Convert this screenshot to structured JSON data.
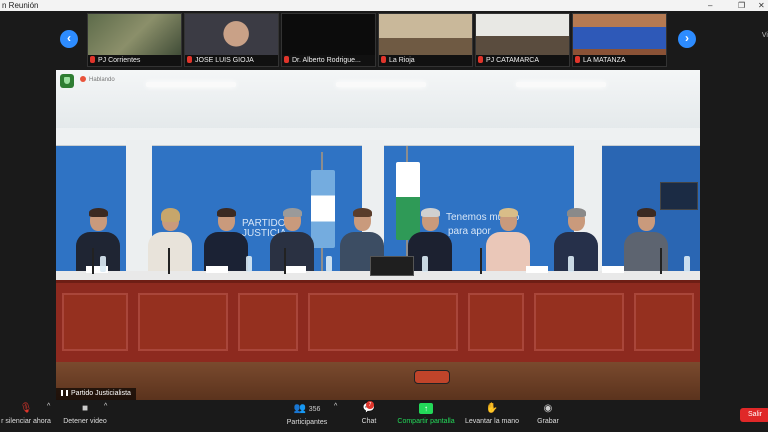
{
  "window": {
    "title": "n Reunión"
  },
  "thumbnails": [
    {
      "label": "PJ Corrientes"
    },
    {
      "label": "JOSE LUIS GIOJA"
    },
    {
      "label": "Dr. Alberto Rodrigue..."
    },
    {
      "label": "La Rioja"
    },
    {
      "label": "PJ CATAMARCA"
    },
    {
      "label": "LA MATANZA"
    }
  ],
  "view_link": "Vi",
  "main_video": {
    "speaking": "Hablando",
    "participant": "Partido Justicialista",
    "wall_text_left_1": "PARTIDO",
    "wall_text_left_2": "JUSTICIA",
    "wall_text_right_1": "Tenemos mucho",
    "wall_text_right_2": "para apor"
  },
  "toolbar": {
    "mute": "r silenciar ahora",
    "stop_video": "Detener video",
    "participants": "Participantes",
    "participant_count": "356",
    "chat": "Chat",
    "chat_badge": "7",
    "share": "Compartir pantalla",
    "raise_hand": "Levantar la mano",
    "record": "Grabar",
    "leave": "Salir"
  },
  "colors": {
    "accent": "#2d8cff",
    "share": "#23d959",
    "leave": "#e02828",
    "wall": "#2f73c4",
    "desk": "#8d2a1f"
  }
}
